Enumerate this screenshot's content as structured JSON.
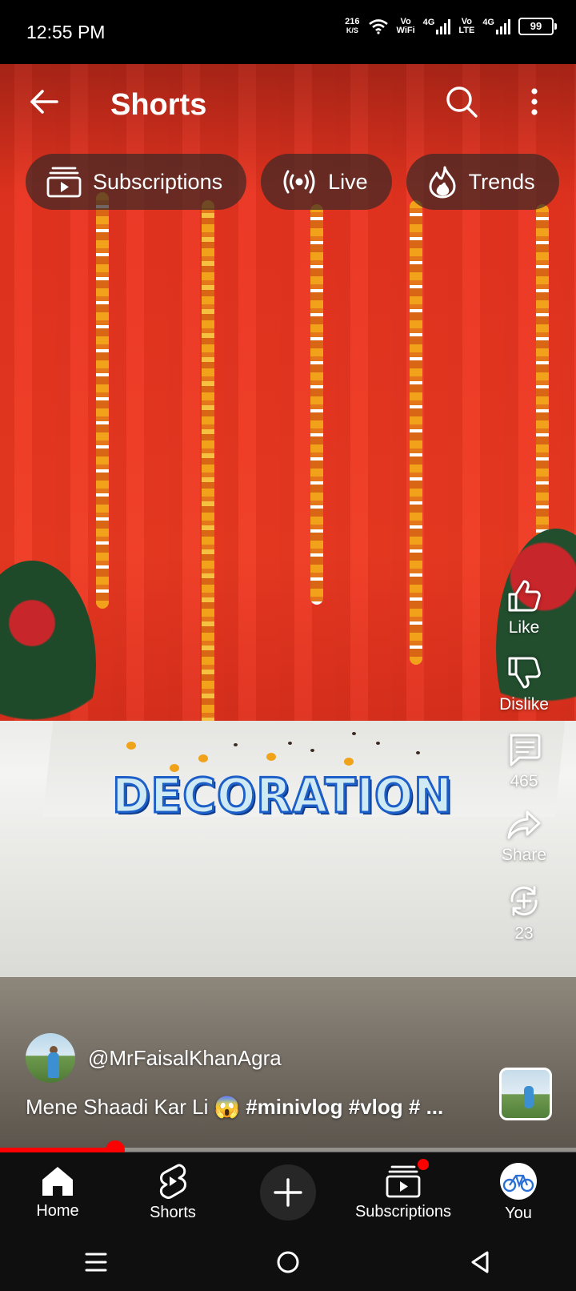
{
  "status": {
    "time": "12:55 PM",
    "net_speed_value": "216",
    "net_speed_unit": "K/S",
    "sim1_label_top": "Vo",
    "sim1_label_bottom": "WiFi",
    "sim1_gen": "4G",
    "sim2_label_top": "Vo",
    "sim2_label_bottom": "LTE",
    "sim2_gen": "4G",
    "battery": "99"
  },
  "header": {
    "title": "Shorts",
    "back_icon": "arrow-left-icon",
    "search_icon": "search-icon",
    "menu_icon": "more-vertical-icon"
  },
  "chips": [
    {
      "label": "Subscriptions",
      "icon": "subscriptions-icon"
    },
    {
      "label": "Live",
      "icon": "live-icon"
    },
    {
      "label": "Trends",
      "icon": "trends-icon"
    }
  ],
  "video": {
    "overlay_text": "DECORATION"
  },
  "actions": {
    "like_label": "Like",
    "dislike_label": "Dislike",
    "comments_count": "465",
    "share_label": "Share",
    "remix_count": "23"
  },
  "channel": {
    "handle": "@MrFaisalKhanAgra"
  },
  "caption": {
    "text": "Mene Shaadi Kar Li 😱 ",
    "tags": "#minivlog #vlog # ..."
  },
  "progress": {
    "played_fraction": 0.2
  },
  "nav": {
    "home": "Home",
    "shorts": "Shorts",
    "subscriptions": "Subscriptions",
    "you": "You"
  },
  "colors": {
    "accent": "#ff0000",
    "overlay_text_fill": "#cfeaf3",
    "overlay_text_stroke": "#1d5fc8"
  }
}
